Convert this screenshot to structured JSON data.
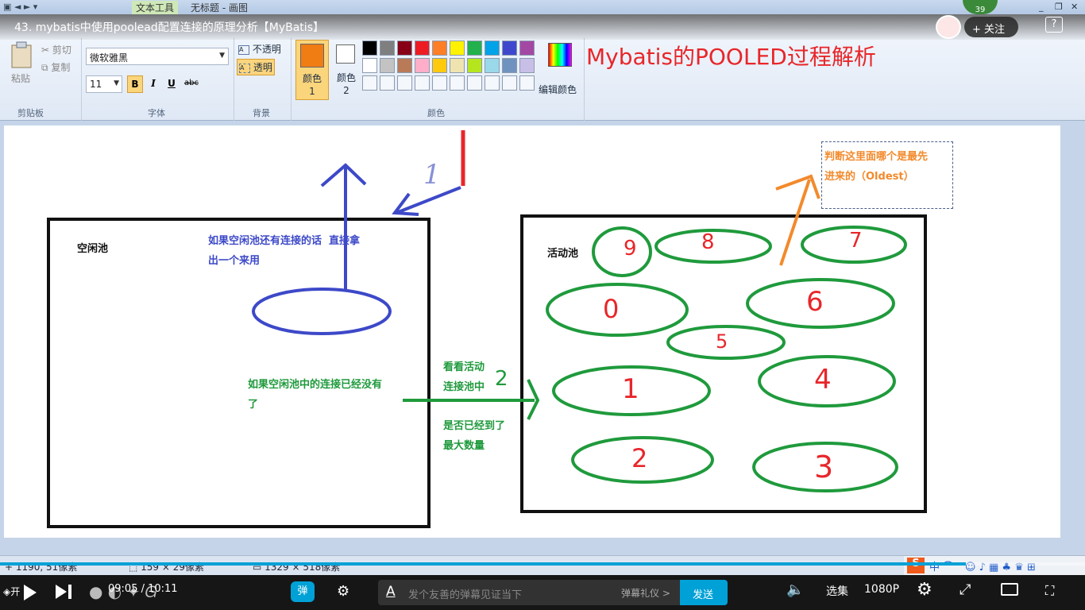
{
  "paint": {
    "qat_items": [
      "文本工具",
      "无标题 - 画图"
    ],
    "clipboard": {
      "paste": "粘贴",
      "cut": "剪切",
      "copy": "复制",
      "group": "剪贴板"
    },
    "font": {
      "family": "微软雅黑",
      "size": "11",
      "group": "字体",
      "bold": "B",
      "italic": "I",
      "underline": "U",
      "strike": "abc"
    },
    "background": {
      "opaque": "不透明",
      "transparent": "透明",
      "group": "背景"
    },
    "colors": {
      "color1": "颜色 1",
      "color2": "颜色 2",
      "edit": "编辑颜色",
      "group": "颜色",
      "active_color": "#f07c14"
    },
    "palette_row1": [
      "#000000",
      "#7f7f7f",
      "#880015",
      "#ed1c24",
      "#ff7f27",
      "#fff200",
      "#22b14c",
      "#00a2e8",
      "#3f48cc",
      "#a349a4"
    ],
    "palette_row2": [
      "#ffffff",
      "#c3c3c3",
      "#b97a57",
      "#ffaec9",
      "#ffc90e",
      "#efe4b0",
      "#b5e61d",
      "#99d9ea",
      "#7092be",
      "#c8bfe7"
    ]
  },
  "canvas": {
    "heading": "Mybatis的POOLED过程解析",
    "idle_pool_label": "空闲池",
    "idle_note": "如果空闲池还有连接的话  直接拿\n出一个来用",
    "idle_empty_note": "如果空闲池中的连接已经没有\n了",
    "check_active_note": "看看活动\n连接池中",
    "max_note": "是否已经到了\n最大数量",
    "active_pool_label": "活动池",
    "oldest_note": "判断这里面哪个是最先\n进来的（Oldest）",
    "step1": "1",
    "step2": "2",
    "connections": [
      "0",
      "1",
      "2",
      "3",
      "4",
      "5",
      "6",
      "7",
      "8",
      "9"
    ]
  },
  "statusbar": {
    "cursor": "1190, 51像素",
    "selection": "159 × 29像素",
    "canvas_size": "1329 × 518像素"
  },
  "player": {
    "title": "43. mybatis中使用poolead配置连接的原理分析【MyBatis】",
    "follow": "+ 关注",
    "time": "09:05 / 10:11",
    "danmaku_placeholder": "发个友善的弹幕见证当下",
    "danmaku_etiquette": "弹幕礼仪 >",
    "send": "发送",
    "episodes": "选集",
    "quality": "1080P",
    "progress": 0.89,
    "danmaku_badge": "弹",
    "viewer_count": "39"
  }
}
